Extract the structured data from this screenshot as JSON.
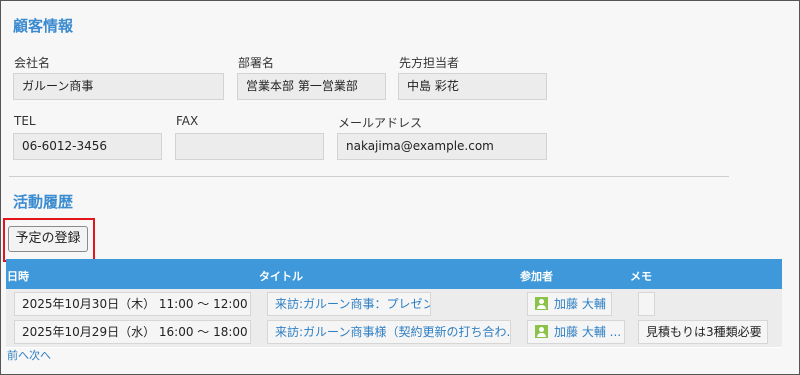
{
  "customer": {
    "section_title": "顧客情報",
    "company_label": "会社名",
    "company_value": "ガルーン商事",
    "department_label": "部署名",
    "department_value": "営業本部 第一営業部",
    "contact_label": "先方担当者",
    "contact_value": "中島 彩花",
    "tel_label": "TEL",
    "tel_value": "06-6012-3456",
    "fax_label": "FAX",
    "fax_value": "",
    "email_label": "メールアドレス",
    "email_value": "nakajima@example.com"
  },
  "activity": {
    "section_title": "活動履歴",
    "register_button": "予定の登録",
    "columns": {
      "date": "日時",
      "title": "タイトル",
      "participants": "参加者",
      "memo": "メモ"
    },
    "rows": [
      {
        "datetime": "2025年10月30日（木） 11:00 ～ 12:00",
        "title": "来訪:ガルーン商事：プレゼン",
        "participant": "加藤 大輔",
        "memo": ""
      },
      {
        "datetime": "2025年10月29日（水） 16:00 ～ 18:00",
        "title": "来訪:ガルーン商事様（契約更新の打ち合わ...",
        "participant": "加藤 大輔 ...",
        "memo": "見積もりは3種類必要"
      }
    ],
    "pager": "前へ次へ"
  },
  "colors": {
    "accent": "#3b8bd0",
    "header_bg": "#3e98da",
    "highlight": "#e0161c",
    "user_icon": "#8bc34a"
  },
  "icons": {
    "participant": "user-icon"
  }
}
